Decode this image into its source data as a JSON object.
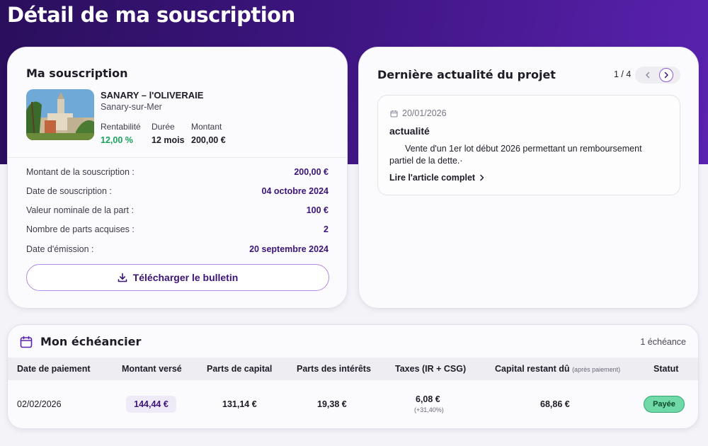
{
  "page": {
    "title": "Détail de ma souscription"
  },
  "subscription": {
    "heading": "Ma souscription",
    "project_name": "SANARY – l'OLIVERAIE",
    "project_city": "Sanary-sur-Mer",
    "kpis": [
      {
        "label": "Rentabilité",
        "value": "12,00 %"
      },
      {
        "label": "Durée",
        "value": "12 mois"
      },
      {
        "label": "Montant",
        "value": "200,00 €"
      }
    ],
    "rows": [
      {
        "label": "Montant de la souscription :",
        "value": "200,00 €"
      },
      {
        "label": "Date de souscription :",
        "value": "04 octobre 2024"
      },
      {
        "label": "Valeur nominale de la part :",
        "value": "100 €"
      },
      {
        "label": "Nombre de parts acquises :",
        "value": "2"
      },
      {
        "label": "Date d'émission :",
        "value": "20 septembre 2024"
      }
    ],
    "download_label": "Télécharger le bulletin"
  },
  "news": {
    "heading": "Dernière actualité du projet",
    "pager": "1 / 4",
    "date": "20/01/2026",
    "title": "actualité",
    "body": "Vente d'un 1er lot début 2026 permettant un remboursement partiel de la dette.·",
    "link": "Lire l'article complet"
  },
  "schedule": {
    "heading": "Mon échéancier",
    "count": "1 échéance",
    "columns": {
      "date": "Date de paiement",
      "amount": "Montant versé",
      "capital": "Parts de capital",
      "interest": "Parts des intérêts",
      "taxes": "Taxes (IR + CSG)",
      "remaining": "Capital restant dû",
      "remaining_note": "(après paiement)",
      "status": "Statut"
    },
    "rows": [
      {
        "date": "02/02/2026",
        "amount": "144,44 €",
        "capital": "131,14 €",
        "interest": "19,38 €",
        "taxes": "6,08 €",
        "taxes_rate": "(+31,40%)",
        "remaining": "68,86 €",
        "status": "Payée"
      }
    ]
  },
  "colors": {
    "brand": "#3b1477",
    "hero": "#3d1580",
    "positive": "#17a35c",
    "status_paid": "#6fd9a8"
  }
}
